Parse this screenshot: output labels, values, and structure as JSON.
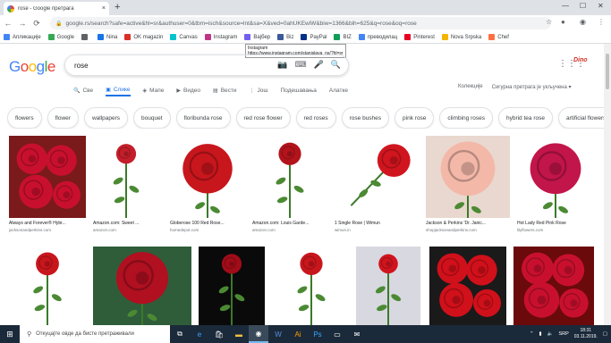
{
  "browser": {
    "tab_title": "rose - Google претрага",
    "tab_close": "×",
    "new_tab": "+",
    "window_controls": [
      "—",
      "☐",
      "✕"
    ],
    "url": "google.rs/search?safe=active&hl=sr&authuser=0&tbm=isch&source=lnt&sa=X&ved=0ahUKEwiW&biw=1366&bih=625&q=rose&oq=rose"
  },
  "bookmarks": [
    {
      "label": "Апликације",
      "color": "#4285f4"
    },
    {
      "label": "Google",
      "color": "#34a853"
    },
    {
      "label": "",
      "color": "#5f6368"
    },
    {
      "label": "Nina",
      "color": "#1a73e8"
    },
    {
      "label": "OK magazin",
      "color": "#d93025"
    },
    {
      "label": "Canvas",
      "color": "#00c4cc"
    },
    {
      "label": "Instagram",
      "color": "#c13584"
    },
    {
      "label": "Вајбер",
      "color": "#7360f2"
    },
    {
      "label": "Biz",
      "color": "#3b5998"
    },
    {
      "label": "PayPal",
      "color": "#003087"
    },
    {
      "label": "BIZ",
      "color": "#0f9d58"
    },
    {
      "label": "преводилац",
      "color": "#4285f4"
    },
    {
      "label": "Pinterest",
      "color": "#e60023"
    },
    {
      "label": "Nova Srpska",
      "color": "#f4b400"
    },
    {
      "label": "Chef",
      "color": "#ff7043"
    }
  ],
  "tooltip": {
    "title": "Instagram",
    "url": "https://www.instagram.com/stanislava_ns/?hl=sr"
  },
  "google": {
    "logo": [
      "G",
      "o",
      "o",
      "g",
      "l",
      "e"
    ],
    "logo_colors": [
      "#4285f4",
      "#ea4335",
      "#fbbc05",
      "#4285f4",
      "#34a853",
      "#ea4335"
    ],
    "query": "rose",
    "avatar_text": "Dino"
  },
  "search_tabs": [
    {
      "label": "Све",
      "icon": "🔍",
      "active": false
    },
    {
      "label": "Слике",
      "icon": "▣",
      "active": true
    },
    {
      "label": "Мапе",
      "icon": "◈",
      "active": false
    },
    {
      "label": "Видео",
      "icon": "▶",
      "active": false
    },
    {
      "label": "Вести",
      "icon": "▤",
      "active": false
    },
    {
      "label": "Још",
      "icon": "⋮",
      "active": false
    },
    {
      "label": "Подешавања",
      "icon": "",
      "active": false
    },
    {
      "label": "Алатке",
      "icon": "",
      "active": false
    }
  ],
  "search_tabs_right": [
    "Колекције",
    "Сигурна претрага је укључена ▾"
  ],
  "chips": [
    "flowers",
    "flower",
    "wallpapers",
    "bouquet",
    "floribunda rose",
    "red rose flower",
    "red roses",
    "rose bushes",
    "pink rose",
    "climbing roses",
    "hybrid tea rose",
    "artificial flowers"
  ],
  "images_row1": [
    {
      "caption": "Always and Forever® Hybr...",
      "source": "jacksonandperkins.com",
      "bg": "#7a1a1a",
      "rose": "#c8102e",
      "type": "cluster"
    },
    {
      "caption": "Amazon.com: Sweet ...",
      "source": "amazon.com",
      "bg": "#ffffff",
      "rose": "#c41e2a",
      "type": "stem"
    },
    {
      "caption": "Globerose 100 Red Rose...",
      "source": "homedepot.com",
      "bg": "#ffffff",
      "rose": "#c8161d",
      "type": "big"
    },
    {
      "caption": "Amazon.com: Louis Garde...",
      "source": "amazon.com",
      "bg": "#ffffff",
      "rose": "#b3141c",
      "type": "stem"
    },
    {
      "caption": "1 Single Rose | Wimun",
      "source": "wimun.in",
      "bg": "#ffffff",
      "rose": "#d0151e",
      "type": "side"
    },
    {
      "caption": "Jackson & Perkins 'Dr. Janic...",
      "source": "shopjacksonandperkins.com",
      "bg": "#e9d8cf",
      "rose": "#f3b8a8",
      "type": "big"
    },
    {
      "caption": "Hot Lady Red Pink Rose",
      "source": "lilyflowers.com",
      "bg": "#ffffff",
      "rose": "#c2154a",
      "type": "big"
    }
  ],
  "images_row2": [
    {
      "bg": "#ffffff",
      "rose": "#c8161d",
      "type": "stem"
    },
    {
      "bg": "#2f5d3a",
      "rose": "#b01020",
      "type": "big"
    },
    {
      "bg": "#0a0a0a",
      "rose": "#a00c18",
      "type": "stem"
    },
    {
      "bg": "#ffffff",
      "rose": "#c8161d",
      "type": "stem"
    },
    {
      "bg": "#d8d8e0",
      "rose": "#d0141e",
      "type": "stem"
    },
    {
      "bg": "#1a1a1a",
      "rose": "#d0101a",
      "type": "cluster"
    },
    {
      "bg": "#6a0a0a",
      "rose": "#c8102e",
      "type": "cluster"
    }
  ],
  "taskbar": {
    "search_placeholder": "Откуцајте овде да бисте претраживали",
    "lang": "SRP",
    "time": "18:31",
    "date": "03.11.2019."
  }
}
